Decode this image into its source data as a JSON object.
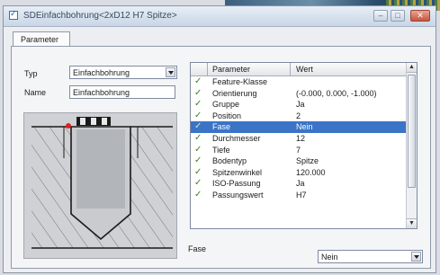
{
  "window": {
    "title": "SDEinfachbohrung<2xD12 H7 Spitze>",
    "controls": {
      "minimize": "–",
      "maximize": "□",
      "close": "✕"
    }
  },
  "tabs": [
    {
      "label": "Parameter",
      "active": true
    }
  ],
  "form": {
    "typ_label": "Typ",
    "typ_value": "Einfachbohrung",
    "name_label": "Name",
    "name_value": "Einfachbohrung"
  },
  "grid": {
    "columns": [
      "Parameter",
      "Wert"
    ],
    "rows": [
      {
        "name": "Feature-Klasse",
        "value": "",
        "selected": false
      },
      {
        "name": "Orientierung",
        "value": "(-0.000, 0.000, -1.000)",
        "selected": false
      },
      {
        "name": "Gruppe",
        "value": "Ja",
        "selected": false
      },
      {
        "name": "Position",
        "value": "2",
        "selected": false
      },
      {
        "name": "Fase",
        "value": "Nein",
        "selected": true
      },
      {
        "name": "Durchmesser",
        "value": "12",
        "selected": false
      },
      {
        "name": "Tiefe",
        "value": "7",
        "selected": false
      },
      {
        "name": "Bodentyp",
        "value": "Spitze",
        "selected": false
      },
      {
        "name": "Spitzenwinkel",
        "value": "120.000",
        "selected": false
      },
      {
        "name": "ISO-Passung",
        "value": "Ja",
        "selected": false
      },
      {
        "name": "Passungswert",
        "value": "H7",
        "selected": false
      }
    ],
    "scroll_up": "▲",
    "scroll_down": "▼"
  },
  "bottom": {
    "label": "Fase",
    "value": "Nein"
  },
  "colors": {
    "selection": "#3b74c7",
    "check": "#3f7f2e",
    "highlight_point": "#e02020"
  }
}
